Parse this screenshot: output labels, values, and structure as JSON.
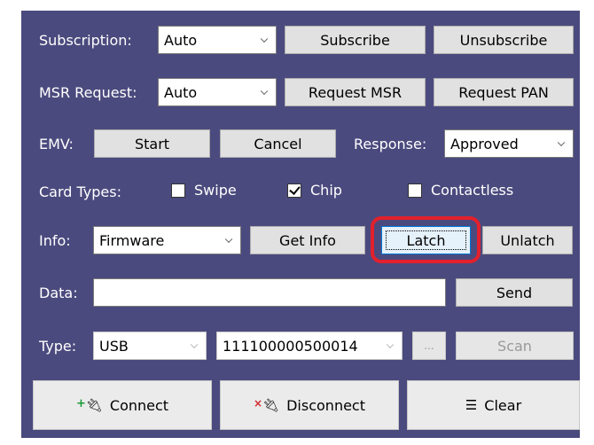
{
  "subscription": {
    "label": "Subscription:",
    "mode": "Auto",
    "subscribe": "Subscribe",
    "unsubscribe": "Unsubscribe"
  },
  "msr": {
    "label": "MSR Request:",
    "mode": "Auto",
    "request_msr": "Request MSR",
    "request_pan": "Request PAN"
  },
  "emv": {
    "label": "EMV:",
    "start": "Start",
    "cancel": "Cancel",
    "response_label": "Response:",
    "response": "Approved"
  },
  "card_types": {
    "label": "Card Types:",
    "swipe": {
      "label": "Swipe",
      "checked": false
    },
    "chip": {
      "label": "Chip",
      "checked": true
    },
    "contactless": {
      "label": "Contactless",
      "checked": false
    }
  },
  "info": {
    "label": "Info:",
    "selected": "Firmware",
    "get_info": "Get Info",
    "latch": "Latch",
    "unlatch": "Unlatch"
  },
  "data_row": {
    "label": "Data:",
    "value": "",
    "send": "Send"
  },
  "connection": {
    "type_label": "Type:",
    "type": "USB",
    "device": "111100000500014",
    "browse": "...",
    "scan": "Scan"
  },
  "actions": {
    "connect": "Connect",
    "disconnect": "Disconnect",
    "clear": "Clear"
  },
  "colors": {
    "panel_bg": "#4b4a7e",
    "highlight": "#e3202c",
    "focus_border": "#0078d7"
  }
}
